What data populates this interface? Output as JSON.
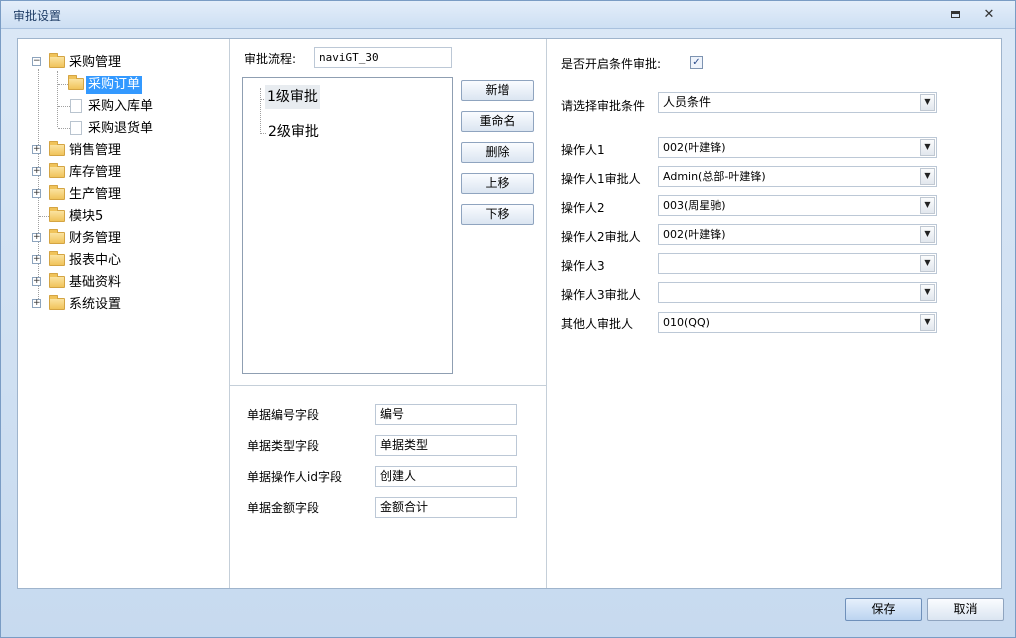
{
  "window": {
    "title": "审批设置"
  },
  "tree": {
    "items": [
      {
        "label": "采购管理",
        "expander": "−"
      },
      {
        "label": "采购订单"
      },
      {
        "label": "采购入库单"
      },
      {
        "label": "采购退货单"
      },
      {
        "label": "销售管理",
        "expander": "+"
      },
      {
        "label": "库存管理",
        "expander": "+"
      },
      {
        "label": "生产管理",
        "expander": "+"
      },
      {
        "label": "模块5"
      },
      {
        "label": "财务管理",
        "expander": "+"
      },
      {
        "label": "报表中心",
        "expander": "+"
      },
      {
        "label": "基础资料",
        "expander": "+"
      },
      {
        "label": "系统设置",
        "expander": "+"
      }
    ]
  },
  "flow": {
    "label": "审批流程:",
    "name_value": "naviGT_30",
    "items": [
      "1级审批",
      "2级审批"
    ],
    "buttons": {
      "add": "新增",
      "rename": "重命名",
      "delete": "删除",
      "up": "上移",
      "down": "下移"
    }
  },
  "fields": {
    "rows": [
      {
        "label": "单据编号字段",
        "value": "编号"
      },
      {
        "label": "单据类型字段",
        "value": "单据类型"
      },
      {
        "label": "单据操作人id字段",
        "value": "创建人"
      },
      {
        "label": "单据金额字段",
        "value": "金额合计"
      }
    ]
  },
  "conditions": {
    "enable_label": "是否开启条件审批:",
    "enable_checked": "✓",
    "condition_label": "请选择审批条件",
    "condition_value": "人员条件",
    "rows": [
      {
        "label": "操作人1",
        "value": "002(叶建锋)"
      },
      {
        "label": "操作人1审批人",
        "value": "Admin(总部-叶建锋)"
      },
      {
        "label": "操作人2",
        "value": "003(周星驰)"
      },
      {
        "label": "操作人2审批人",
        "value": "002(叶建锋)"
      },
      {
        "label": "操作人3",
        "value": ""
      },
      {
        "label": "操作人3审批人",
        "value": ""
      },
      {
        "label": "其他人审批人",
        "value": "010(QQ)"
      }
    ]
  },
  "footer": {
    "save": "保存",
    "cancel": "取消"
  },
  "icons": {
    "minimize": "minimize-icon",
    "close": "close-icon",
    "folder": "folder-icon",
    "document": "document-icon",
    "dropdown": "chevron-down-icon"
  }
}
